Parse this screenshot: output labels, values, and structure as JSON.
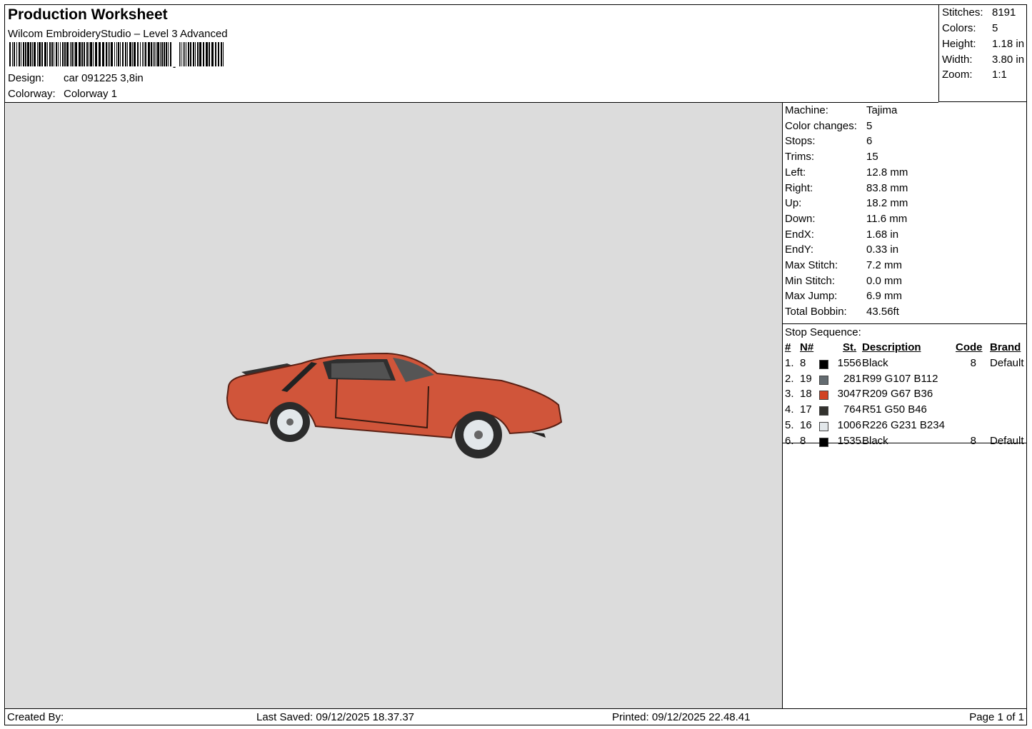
{
  "header": {
    "title": "Production Worksheet",
    "software": "Wilcom EmbroideryStudio – Level 3 Advanced",
    "design_label": "Design:",
    "design_value": "car 091225 3,8in",
    "colorway_label": "Colorway:",
    "colorway_value": "Colorway 1"
  },
  "stats": {
    "stitches_label": "Stitches:",
    "stitches": "8191",
    "colors_label": "Colors:",
    "colors": "5",
    "height_label": "Height:",
    "height": "1.18 in",
    "width_label": "Width:",
    "width": "3.80 in",
    "zoom_label": "Zoom:",
    "zoom": "1:1"
  },
  "machine_info": [
    {
      "label": "Machine:",
      "value": "Tajima"
    },
    {
      "label": "Color changes:",
      "value": "5"
    },
    {
      "label": "Stops:",
      "value": "6"
    },
    {
      "label": "Trims:",
      "value": "15"
    },
    {
      "label": "Left:",
      "value": "12.8 mm"
    },
    {
      "label": "Right:",
      "value": "83.8 mm"
    },
    {
      "label": "Up:",
      "value": "18.2 mm"
    },
    {
      "label": "Down:",
      "value": "11.6 mm"
    },
    {
      "label": "EndX:",
      "value": "1.68 in"
    },
    {
      "label": "EndY:",
      "value": "0.33 in"
    },
    {
      "label": "Max Stitch:",
      "value": "7.2 mm"
    },
    {
      "label": "Min Stitch:",
      "value": "0.0 mm"
    },
    {
      "label": "Max Jump:",
      "value": "6.9 mm"
    },
    {
      "label": "Total Bobbin:",
      "value": "43.56ft"
    }
  ],
  "stop_sequence": {
    "title": "Stop Sequence:",
    "columns": {
      "num": "#",
      "needle": "N#",
      "stitches": "St.",
      "description": "Description",
      "code": "Code",
      "brand": "Brand"
    },
    "rows": [
      {
        "num": "1.",
        "needle": "8",
        "stitches": "1556",
        "description": "Black",
        "code": "8",
        "brand": "Default",
        "color": "#000000"
      },
      {
        "num": "2.",
        "needle": "19",
        "stitches": "281",
        "description": "R99 G107 B112",
        "code": "",
        "brand": "",
        "color": "#636b70"
      },
      {
        "num": "3.",
        "needle": "18",
        "stitches": "3047",
        "description": "R209 G67 B36",
        "code": "",
        "brand": "",
        "color": "#d14324"
      },
      {
        "num": "4.",
        "needle": "17",
        "stitches": "764",
        "description": "R51 G50 B46",
        "code": "",
        "brand": "",
        "color": "#33322e"
      },
      {
        "num": "5.",
        "needle": "16",
        "stitches": "1006",
        "description": "R226 G231 B234",
        "code": "",
        "brand": "",
        "color": "#e2e7ea"
      },
      {
        "num": "6.",
        "needle": "8",
        "stitches": "1535",
        "description": "Black",
        "code": "8",
        "brand": "Default",
        "color": "#000000"
      }
    ]
  },
  "footer": {
    "created_by": "Created By:",
    "last_saved": "Last Saved: 09/12/2025 18.37.37",
    "printed": "Printed: 09/12/2025 22.48.41",
    "page": "Page 1 of 1"
  },
  "preview": {
    "background": "#dcdcdc",
    "body_color": "#d0553a"
  }
}
